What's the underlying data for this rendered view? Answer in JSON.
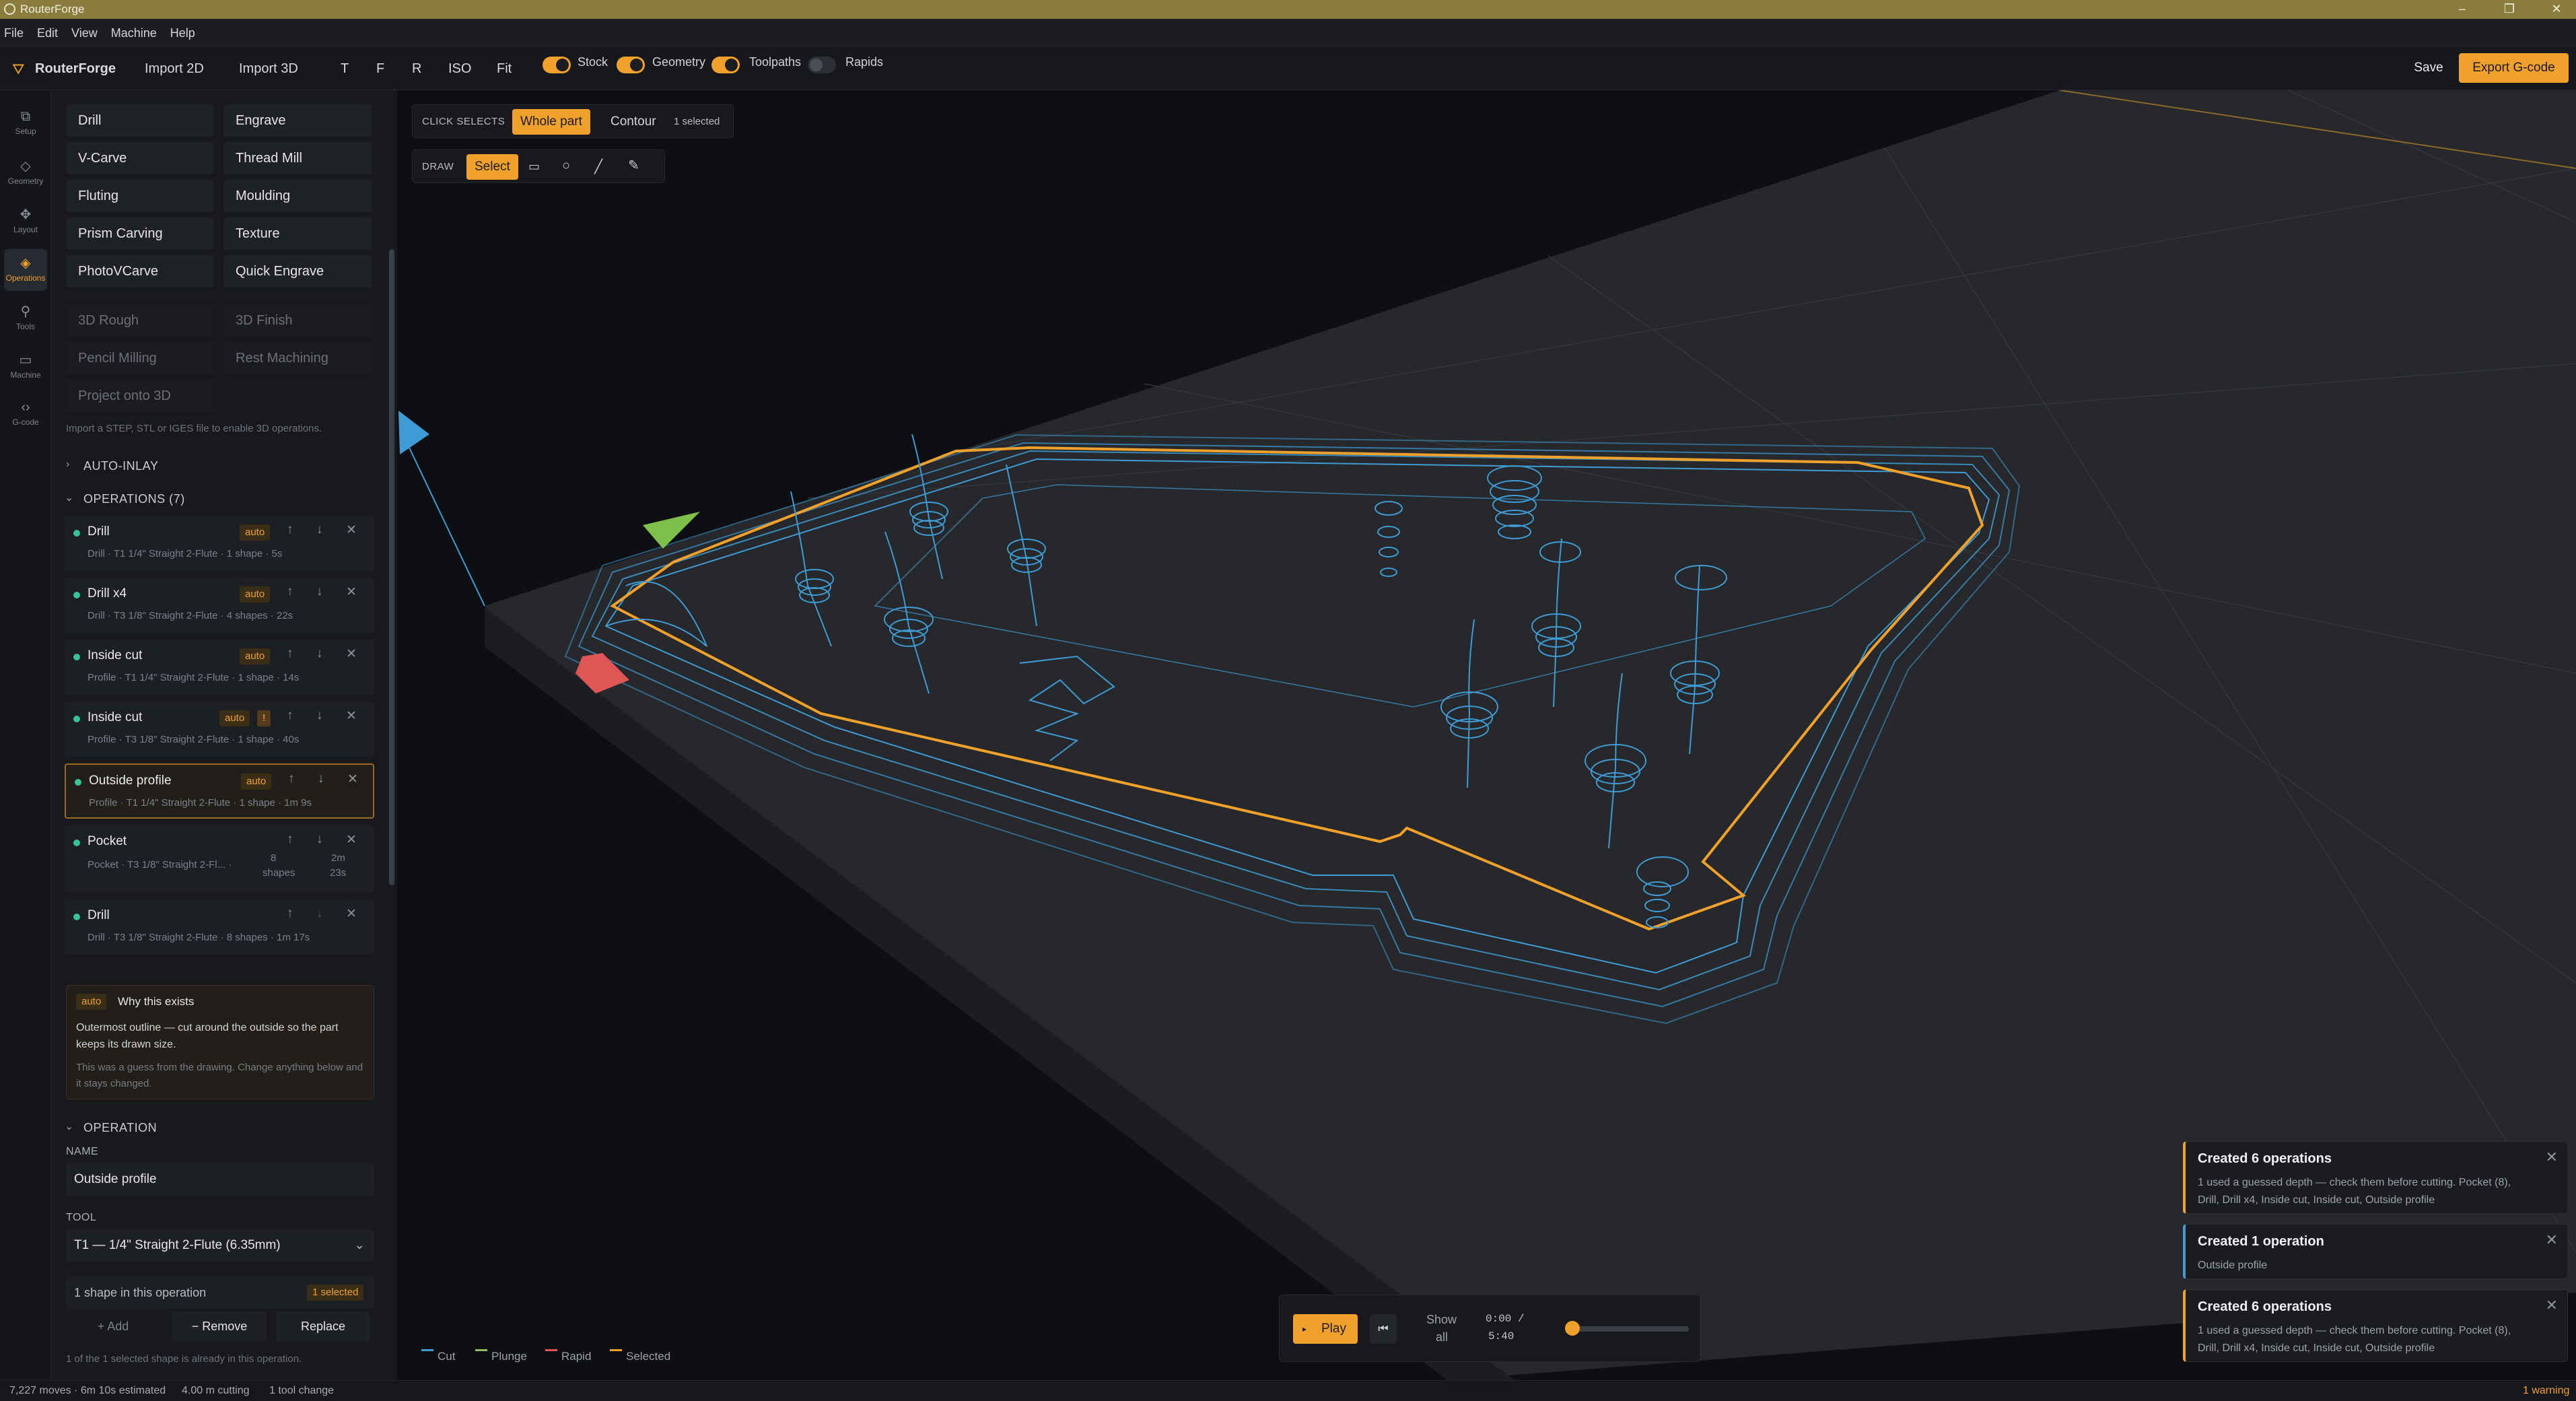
{
  "window": {
    "title": "RouterForge",
    "controls": [
      "–",
      "❐",
      "✕"
    ]
  },
  "menu": [
    "File",
    "Edit",
    "View",
    "Machine",
    "Help"
  ],
  "toolbar": {
    "brand": "RouterForge",
    "import_2d": "Import 2D",
    "import_3d": "Import 3D",
    "views": [
      "T",
      "F",
      "R",
      "ISO",
      "Fit"
    ],
    "toggles": [
      {
        "label": "Stock",
        "on": true
      },
      {
        "label": "Geometry",
        "on": true
      },
      {
        "label": "Toolpaths",
        "on": true
      },
      {
        "label": "Rapids",
        "on": false
      }
    ],
    "save": "Save",
    "export": "Export G-code"
  },
  "rail": [
    {
      "label": "Setup",
      "icon": "stack-icon"
    },
    {
      "label": "Geometry",
      "icon": "shapes-icon"
    },
    {
      "label": "Layout",
      "icon": "move-icon"
    },
    {
      "label": "Operations",
      "icon": "layers-icon",
      "active": true
    },
    {
      "label": "Tools",
      "icon": "tool-icon"
    },
    {
      "label": "Machine",
      "icon": "monitor-icon"
    },
    {
      "label": "G-code",
      "icon": "code-icon"
    }
  ],
  "operation_types": {
    "enabled": [
      "Drill",
      "Engrave",
      "V-Carve",
      "Thread Mill",
      "Fluting",
      "Moulding",
      "Prism Carving",
      "Texture",
      "PhotoVCarve",
      "Quick Engrave"
    ],
    "disabled": [
      "3D Rough",
      "3D Finish",
      "Pencil Milling",
      "Rest Machining",
      "Project onto 3D"
    ],
    "hint": "Import a STEP, STL or IGES file to enable 3D operations."
  },
  "auto_inlay": "AUTO-INLAY",
  "operations_header": "OPERATIONS (7)",
  "operations": [
    {
      "name": "Drill",
      "badge": "auto",
      "sub": "Drill  ·  T1 1/4\" Straight 2-Flute  ·  1 shape  ·  5s"
    },
    {
      "name": "Drill x4",
      "badge": "auto",
      "sub": "Drill  ·  T3 1/8\" Straight 2-Flute  ·  4 shapes  ·  22s"
    },
    {
      "name": "Inside cut",
      "badge": "auto",
      "sub": "Profile  ·  T1 1/4\" Straight 2-Flute  ·  1 shape  ·  14s"
    },
    {
      "name": "Inside cut",
      "badge": "auto",
      "warn": "!",
      "sub": "Profile  ·  T3 1/8\" Straight 2-Flute  ·  1 shape  ·  40s"
    },
    {
      "name": "Outside profile",
      "badge": "auto",
      "selected": true,
      "sub": "Profile  ·  T1 1/4\" Straight 2-Flute  ·  1 shape  ·  1m 9s"
    },
    {
      "name": "Pocket",
      "sub_a": "Pocket  ·  T3 1/8\" Straight 2-Fl...  ·",
      "sub_b": "8",
      "sub_c": "shapes",
      "sub_d": "2m",
      "sub_e": "23s"
    },
    {
      "name": "Drill",
      "sub": "Drill  ·  T3 1/8\" Straight 2-Flute  ·  8 shapes  ·  1m 17s"
    }
  ],
  "why": {
    "badge": "auto",
    "title": "Why this exists",
    "body": "Outermost outline — cut around the outside so the part keeps its drawn size.",
    "note": "This was a guess from the drawing. Change anything below and it stays changed."
  },
  "operation_section": {
    "header": "OPERATION",
    "name_label": "NAME",
    "name_value": "Outside profile",
    "tool_label": "TOOL",
    "tool_value": "T1 — 1/4\" Straight 2-Flute (6.35mm)",
    "shapes_text": "1 shape in this operation",
    "shapes_badge": "1 selected",
    "add": "+ Add",
    "remove": "− Remove",
    "replace": "Replace",
    "note": "1 of the 1 selected shape is already in this operation."
  },
  "viewport": {
    "click_selects": "CLICK SELECTS",
    "modes": [
      "Whole part",
      "Contour"
    ],
    "selected_count": "1 selected",
    "draw": "DRAW",
    "draw_select": "Select",
    "legend": [
      {
        "label": "Cut",
        "color": "#3e9bd4"
      },
      {
        "label": "Plunge",
        "color": "#8fbf5a"
      },
      {
        "label": "Rapid",
        "color": "#e05555"
      },
      {
        "label": "Selected",
        "color": "#f0a12b"
      }
    ],
    "play": "Play",
    "show_all_1": "Show",
    "show_all_2": "all",
    "time_1": "0:00 /",
    "time_2": "5:40",
    "progress": 0.0
  },
  "toasts": [
    {
      "title": "Created 6 operations",
      "body": "1 used a guessed depth — check them before cutting. Pocket (8), Drill, Drill x4, Inside cut, Inside cut, Outside profile"
    },
    {
      "title": "Created 1 operation",
      "body": "Outside profile"
    },
    {
      "title": "Created 6 operations",
      "body": "1 used a guessed depth — check them before cutting. Pocket (8), Drill, Drill x4, Inside cut, Inside cut, Outside profile"
    }
  ],
  "status": {
    "moves": "7,227 moves · 6m 10s estimated",
    "cutting": "4.00 m cutting",
    "tool_change": "1 tool change",
    "warning": "1 warning"
  },
  "colors": {
    "accent": "#f0a12b",
    "toolpath": "#3e9bd4",
    "ok": "#36c497"
  }
}
